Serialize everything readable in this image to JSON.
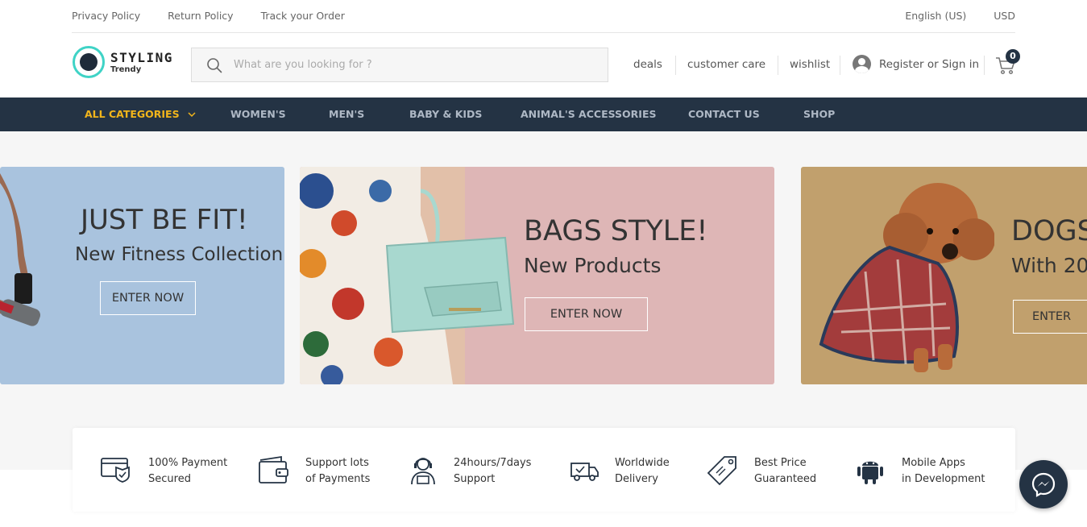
{
  "topbar": {
    "privacy": "Privacy Policy",
    "return": "Return Policy",
    "track": "Track your Order",
    "language": "English (US)",
    "currency": "USD"
  },
  "logo": {
    "name": "STYLING",
    "tagline": "Trendy"
  },
  "search": {
    "placeholder": "What are you looking for ?"
  },
  "header_links": {
    "deals": "deals",
    "customer_care": "customer care",
    "wishlist": "wishlist",
    "account": "Register or Sign in",
    "cart_count": "0"
  },
  "nav": {
    "all_categories": "ALL CATEGORIES",
    "items": [
      "WOMEN'S",
      "MEN'S",
      "BABY & KIDS",
      "ANIMAL'S ACCESSORIES",
      "CONTACT US",
      "SHOP"
    ]
  },
  "banners": [
    {
      "heading": "JUST BE FIT!",
      "subheading": "New Fitness Collection",
      "button": "ENTER NOW",
      "color": "#a9c3de"
    },
    {
      "heading": "BAGS STYLE!",
      "subheading": "New Products",
      "button": "ENTER NOW",
      "color": "#deb6b6"
    },
    {
      "heading": "DOGS",
      "subheading": "With 20",
      "button": "ENTER",
      "color": "#c1a06d"
    }
  ],
  "features": [
    {
      "line1": "100% Payment",
      "line2": "Secured",
      "icon": "card-shield-icon"
    },
    {
      "line1": "Support lots",
      "line2": "of Payments",
      "icon": "wallet-icon"
    },
    {
      "line1": "24hours/7days",
      "line2": "Support",
      "icon": "support-agent-icon"
    },
    {
      "line1": "Worldwide",
      "line2": "Delivery",
      "icon": "delivery-truck-icon"
    },
    {
      "line1": "Best Price",
      "line2": "Guaranteed",
      "icon": "price-tag-icon"
    },
    {
      "line1": "Mobile Apps",
      "line2": "in Development",
      "icon": "android-icon"
    }
  ],
  "colors": {
    "nav_bg": "#243344",
    "accent": "#f2b51b",
    "logo_ring": "#3fd3c6"
  }
}
